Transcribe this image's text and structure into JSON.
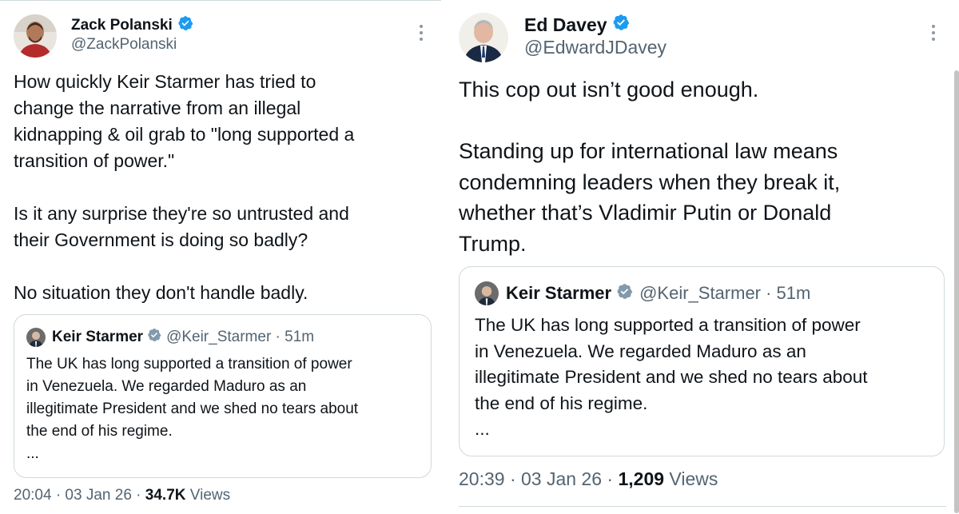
{
  "left_tweet": {
    "author_name": "Zack Polanski",
    "author_handle": "@ZackPolanski",
    "text": "How quickly Keir Starmer has tried to\nchange the narrative from an illegal\nkidnapping & oil grab to \"long supported a\ntransition of power.\"\n\nIs it any surprise they're so untrusted and\ntheir Government is doing so badly?\n\nNo situation they don't handle badly.",
    "quote": {
      "author_name": "Keir Starmer",
      "author_handle": "@Keir_Starmer · 51m",
      "text": "The UK has long supported a transition of power\nin Venezuela. We regarded Maduro as an\nillegitimate President and we shed no tears about\nthe end of his regime.\n...",
      "ellipsis": "..."
    },
    "time": "20:04 · 03 Jan 26 · ",
    "views_count": "34.7K",
    "views_label": " Views"
  },
  "right_tweet": {
    "author_name": "Ed Davey",
    "author_handle": "@EdwardJDavey",
    "text": "This cop out isn’t good enough.\n\nStanding up for international law means\ncondemning leaders when they break it,\nwhether that’s Vladimir Putin or Donald\nTrump.",
    "quote": {
      "author_name": "Keir Starmer",
      "author_handle": "@Keir_Starmer · 51m",
      "text": "The UK has long supported a transition of power\nin Venezuela. We regarded Maduro as an\nillegitimate President and we shed no tears about\nthe end of his regime.\n..."
    },
    "time": "20:39 · 03 Jan 26 · ",
    "views_count": "1,209",
    "views_label": " Views"
  },
  "colors": {
    "verified_blue": "#1d9bf0",
    "muted_text": "#536471",
    "border": "#cfd9de"
  },
  "icons": [
    "verified-badge-icon",
    "more-options-icon"
  ]
}
